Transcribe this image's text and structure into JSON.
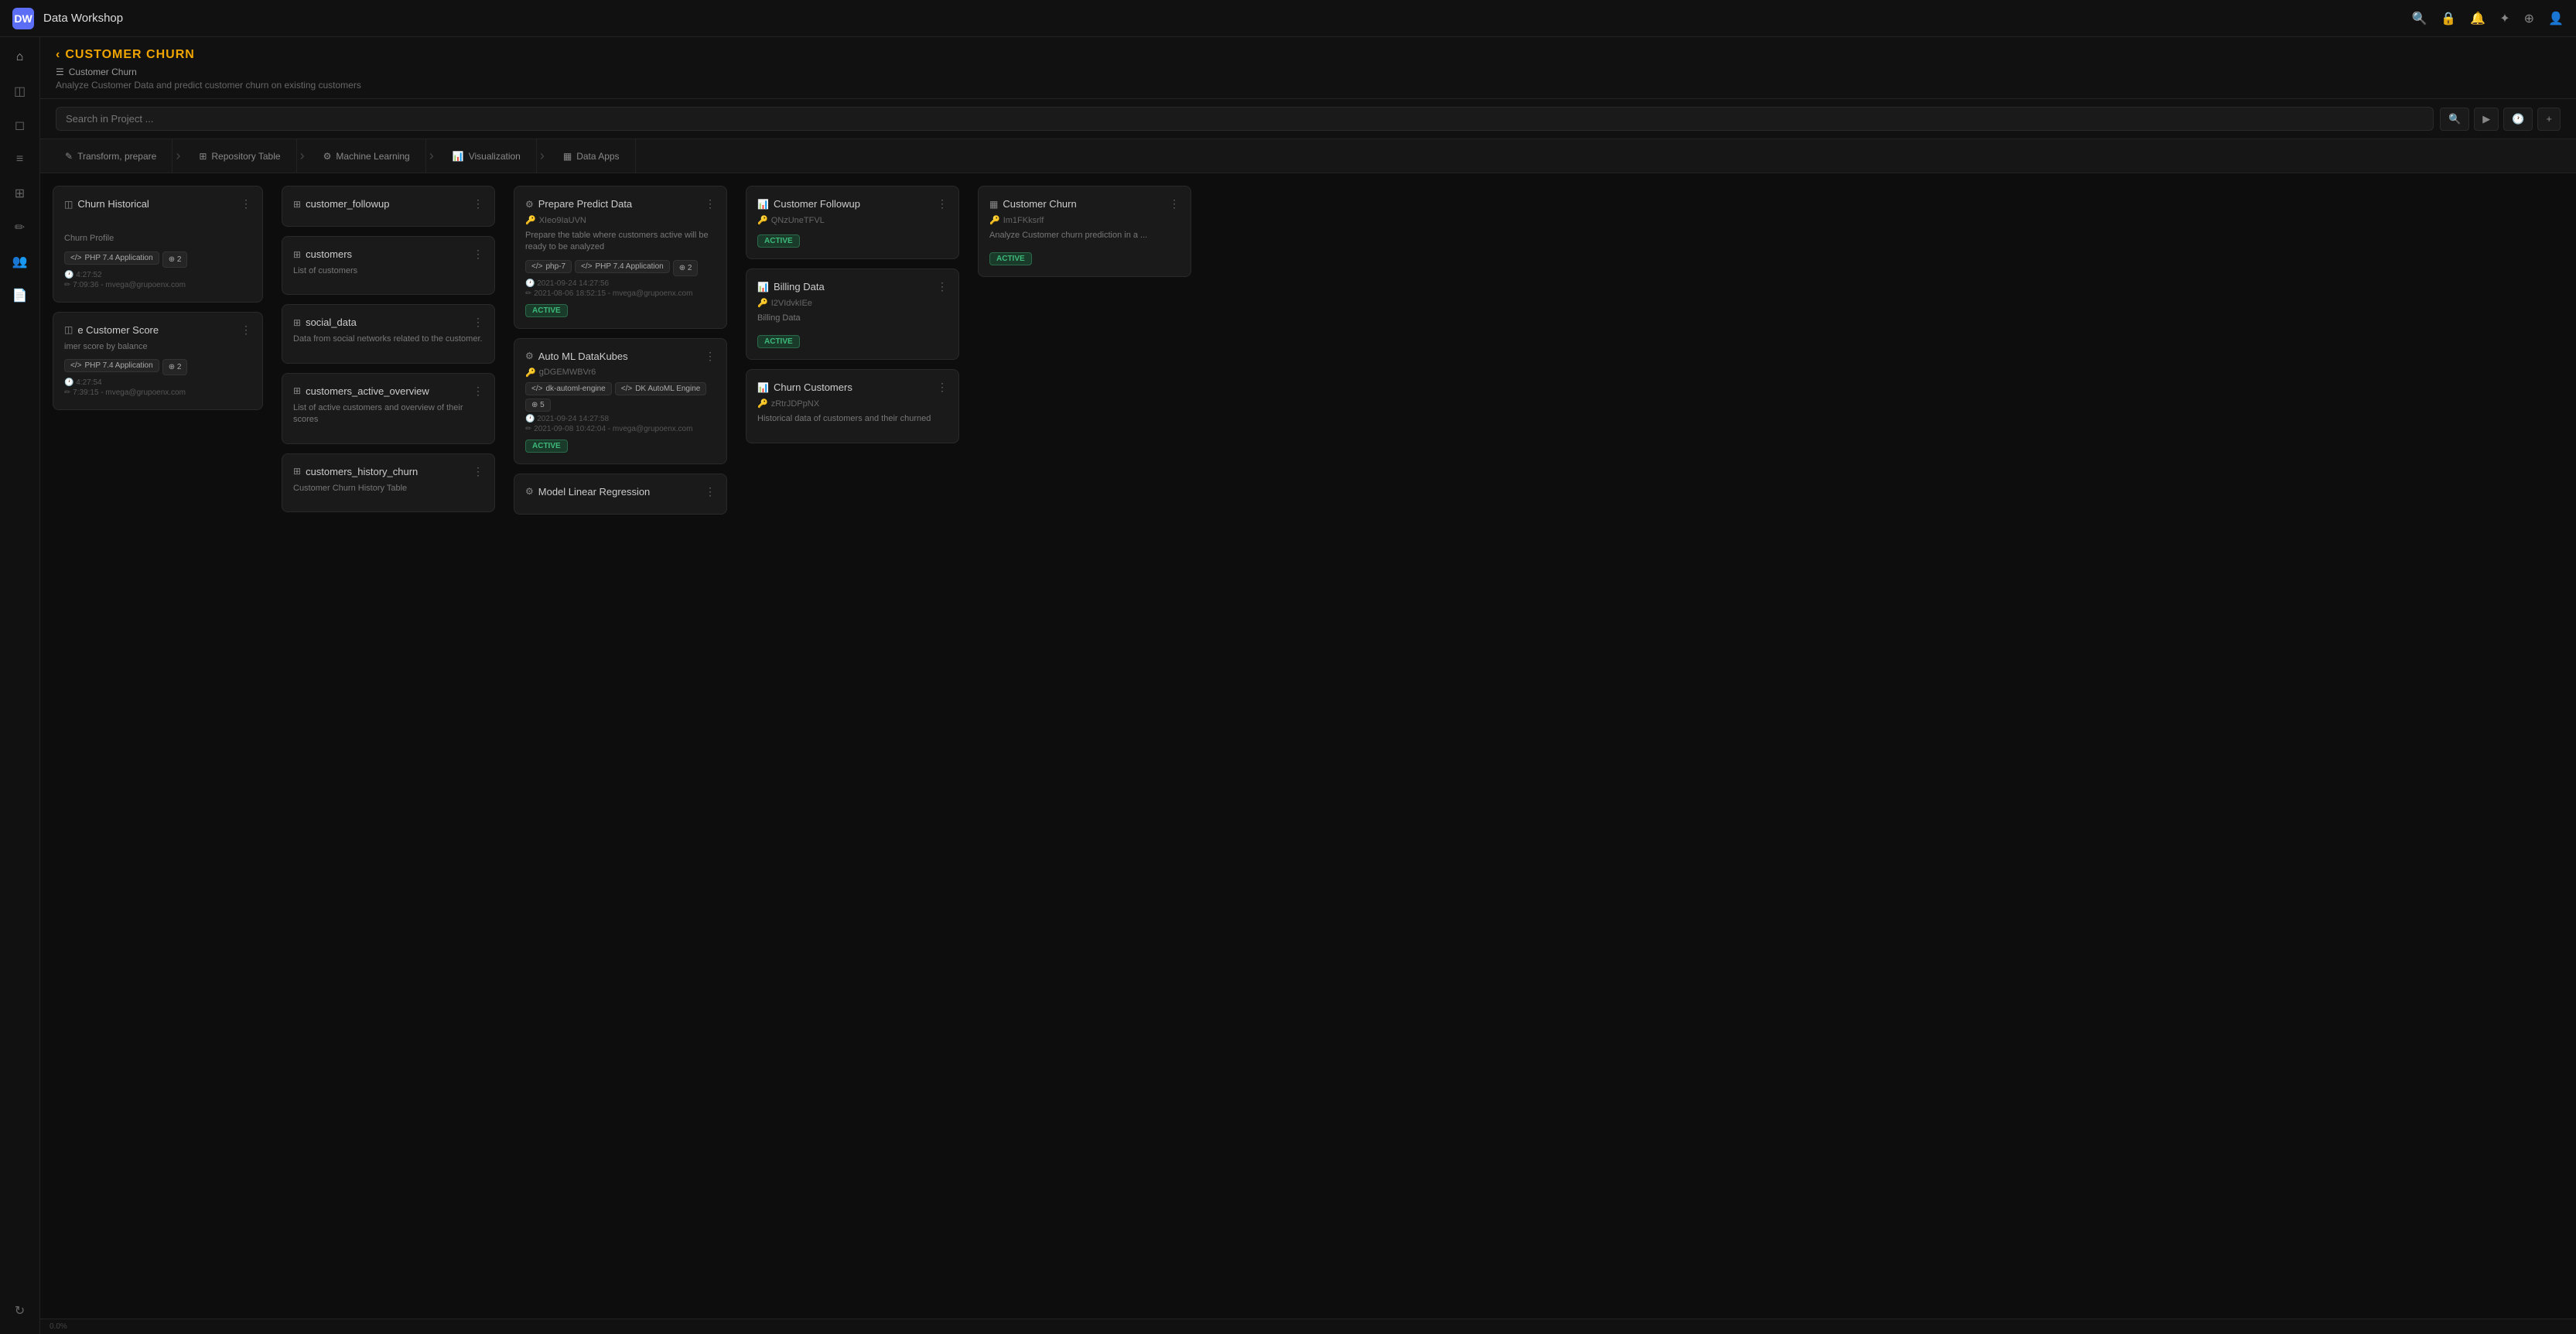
{
  "app": {
    "title": "Data Workshop",
    "logo": "DW"
  },
  "navbar": {
    "icons": [
      "🔍",
      "🔒",
      "🔔",
      "✦",
      "⊕",
      "👤"
    ]
  },
  "sidebar": {
    "icons": [
      {
        "name": "home-icon",
        "symbol": "⌂"
      },
      {
        "name": "chart-icon",
        "symbol": "◫"
      },
      {
        "name": "database-icon",
        "symbol": "◻"
      },
      {
        "name": "data-icon",
        "symbol": "≡"
      },
      {
        "name": "grid-icon",
        "symbol": "⊞"
      },
      {
        "name": "paint-icon",
        "symbol": "✏"
      },
      {
        "name": "users-icon",
        "symbol": "👥"
      },
      {
        "name": "docs-icon",
        "symbol": "📄"
      },
      {
        "name": "refresh-icon",
        "symbol": "↻"
      }
    ]
  },
  "project": {
    "breadcrumb_label": "CUSTOMER CHURN",
    "name": "Customer Churn",
    "description": "Analyze Customer Data and predict customer churn on existing customers"
  },
  "search": {
    "placeholder": "Search in Project ...",
    "btn_search": "🔍",
    "btn_run": "▶",
    "btn_history": "🕐",
    "btn_add": "+"
  },
  "pipeline_tabs": [
    {
      "label": "Transform, prepare",
      "icon": "✎"
    },
    {
      "label": "Repository Table",
      "icon": "⊞"
    },
    {
      "label": "Machine Learning",
      "icon": "⚙"
    },
    {
      "label": "Visualization",
      "icon": "📊"
    },
    {
      "label": "Data Apps",
      "icon": "▦"
    }
  ],
  "columns": {
    "transform": {
      "cards": [
        {
          "title": "Churn Historical",
          "icon": "◫",
          "tags": [
            {
              "label": "PHP 7.4 Application"
            }
          ],
          "count": "2",
          "time1": "4:27:52",
          "time2": "7:09:36 - mvega@grupoenx.com"
        },
        {
          "title": "e Customer Score",
          "icon": "◫",
          "desc": "imer score by balance",
          "tags": [
            {
              "label": "PHP 7.4 Application"
            }
          ],
          "count": "2",
          "time1": "4:27:54",
          "time2": "7:39:15 - mvega@grupoenx.com"
        }
      ]
    },
    "repository": {
      "cards": [
        {
          "title": "customer_followup",
          "icon": "⊞",
          "desc": ""
        },
        {
          "title": "customers",
          "icon": "⊞",
          "desc": "List of customers"
        },
        {
          "title": "social_data",
          "icon": "⊞",
          "desc": "Data from social networks related to the customer."
        },
        {
          "title": "customers_active_overview",
          "icon": "⊞",
          "desc": "List of active customers and overview of their scores"
        },
        {
          "title": "customers_history_churn",
          "icon": "⊞",
          "desc": "Customer Churn History Table"
        }
      ]
    },
    "ml": {
      "cards": [
        {
          "title": "Prepare Predict Data",
          "icon": "⚙",
          "id": "XIeo9IaUVN",
          "desc": "Prepare the table where customers active will be ready to be analyzed",
          "tags": [
            "php-7",
            "PHP 7.4 Application"
          ],
          "count": "2",
          "date1": "2021-09-24 14:27:56",
          "date2": "2021-08-06 18:52:15 - mvega@grupoenx.com",
          "status": "ACTIVE"
        },
        {
          "title": "Auto ML DataKubes",
          "icon": "⚙",
          "id": "gDGEMWBVr6",
          "desc": "",
          "tags": [
            "dk-automl-engine",
            "DK AutoML Engine"
          ],
          "count": "5",
          "date1": "2021-09-24 14:27:58",
          "date2": "2021-09-08 10:42:04 - mvega@grupoenx.com",
          "status": "ACTIVE"
        },
        {
          "title": "Model Linear Regression",
          "icon": "⚙",
          "id": "",
          "desc": "",
          "tags": [],
          "count": "",
          "date1": "",
          "date2": "",
          "status": ""
        }
      ]
    },
    "visualization": {
      "cards": [
        {
          "title": "Customer Followup",
          "icon": "📊",
          "id": "QNzUneTFVL",
          "desc": "",
          "status": "ACTIVE"
        },
        {
          "title": "Billing Data",
          "icon": "📊",
          "id": "I2VIdvkIEe",
          "desc": "Billing Data",
          "status": "ACTIVE"
        },
        {
          "title": "Churn Customers",
          "icon": "📊",
          "id": "zRtrJDPpNX",
          "desc": "Historical data of customers and their churned",
          "status": ""
        }
      ]
    },
    "dataapps": {
      "cards": [
        {
          "title": "Customer Churn",
          "icon": "▦",
          "id": "Im1FKksrlf",
          "desc": "Analyze Customer churn prediction in a ...",
          "status": "ACTIVE"
        }
      ]
    }
  },
  "progress": "0.0%"
}
